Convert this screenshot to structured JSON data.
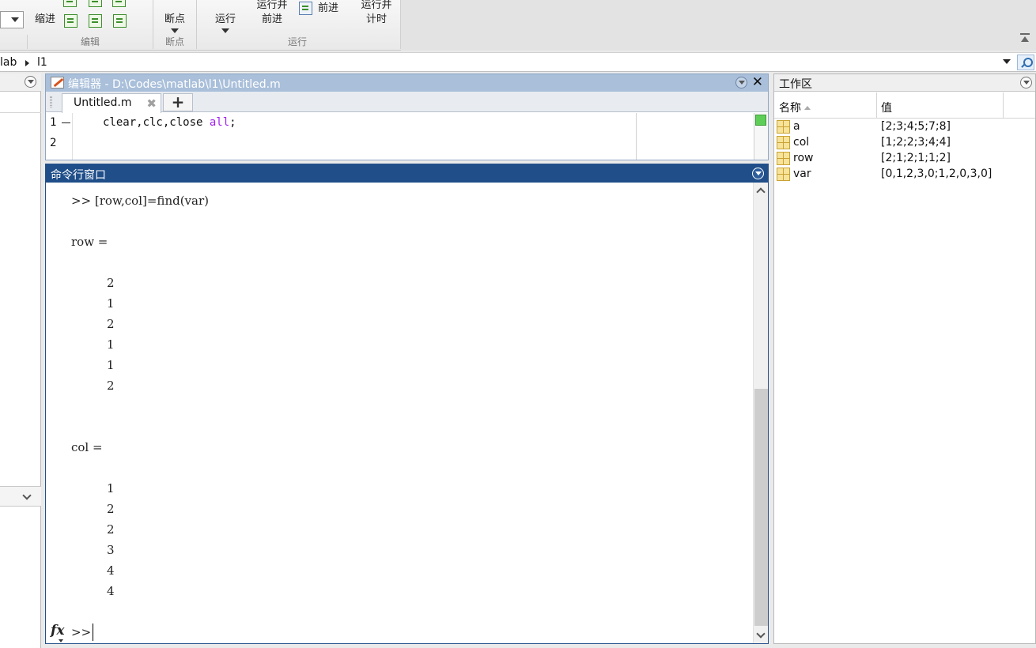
{
  "ribbon": {
    "edit_group": {
      "label": "编辑",
      "indent_label": "缩进"
    },
    "breakpoint_group": {
      "label": "断点",
      "button_label": "断点"
    },
    "run_group": {
      "label": "运行",
      "run_label": "运行",
      "run_advance_label": "运行并\n前进",
      "advance_label": "前进",
      "run_time_label": "运行并\n计时"
    }
  },
  "address_bar": {
    "crumbs": [
      "lab",
      "l1"
    ]
  },
  "editor": {
    "title": "编辑器 - D:\\Codes\\matlab\\l1\\Untitled.m",
    "tab_label": "Untitled.m",
    "add_tab_label": "+",
    "close_label": "✕",
    "lines": [
      {
        "number": "1",
        "code": "clear,clc,close ",
        "keyword": "all",
        "tail": ";"
      },
      {
        "number": "2",
        "code": ""
      }
    ]
  },
  "command_window": {
    "title": "命令行窗口",
    "command": ">> [row,col]=find(var)",
    "outputs": [
      {
        "header": "row =",
        "values": [
          "2",
          "1",
          "2",
          "1",
          "1",
          "2"
        ]
      },
      {
        "header": "col =",
        "values": [
          "1",
          "2",
          "2",
          "3",
          "4",
          "4"
        ]
      }
    ],
    "fx_label": "fx",
    "prompt": ">>"
  },
  "workspace": {
    "title": "工作区",
    "columns": {
      "name": "名称",
      "value": "值"
    },
    "variables": [
      {
        "name": "a",
        "value": "[2;3;4;5;7;8]"
      },
      {
        "name": "col",
        "value": "[1;2;2;3;4;4]"
      },
      {
        "name": "row",
        "value": "[2;1;2;1;1;2]"
      },
      {
        "name": "var",
        "value": "[0,1,2,3,0;1,2,0,3,0]"
      }
    ]
  },
  "colors": {
    "command_title_bg": "#1f4e89",
    "editor_title_bg": "#a9bfda",
    "keyword_string": "#a020f0",
    "status_ok": "#5fce58"
  }
}
